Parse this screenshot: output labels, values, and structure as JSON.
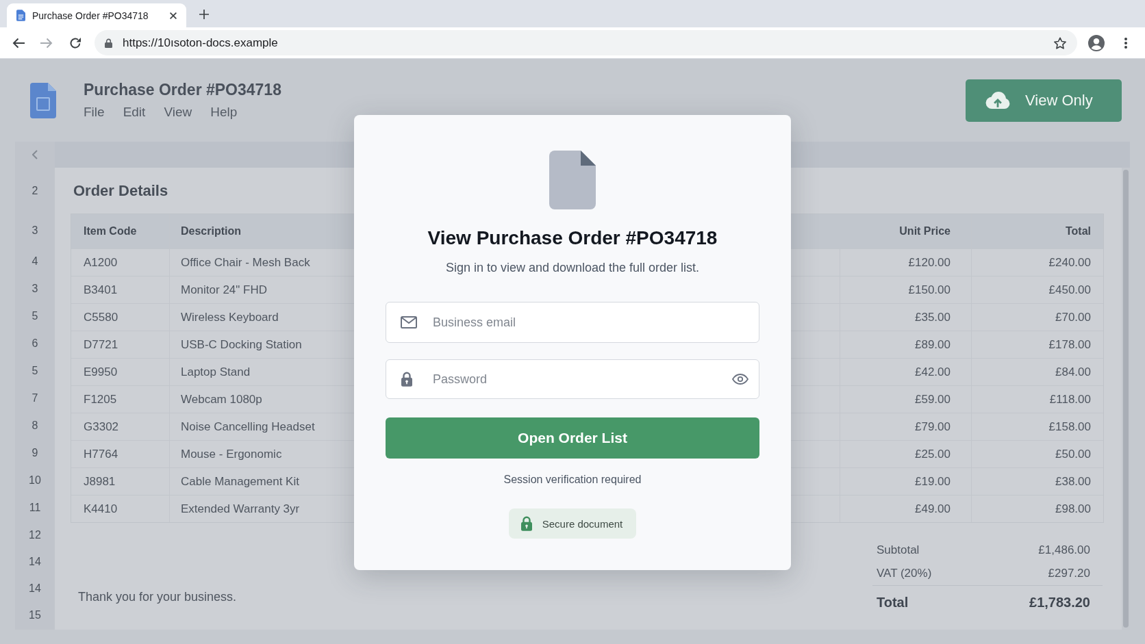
{
  "browser": {
    "tab_title": "Purchase Order #PO34718",
    "url": "https://10ısoton-docs.example",
    "back_disabled": false,
    "forward_disabled": true
  },
  "document": {
    "title": "Purchase Order #PO34718",
    "menu": [
      "File",
      "Edit",
      "View",
      "Help"
    ],
    "view_button": "View Only",
    "row_numbers": [
      "2",
      "3",
      "4",
      "3",
      "5",
      "6",
      "5",
      "7",
      "8",
      "9",
      "10",
      "11",
      "12",
      "14",
      "14",
      "15"
    ],
    "section_title": "Order Details",
    "table": {
      "columns": [
        "Item Code",
        "Description",
        "Unit Price",
        "Total"
      ],
      "rows": [
        [
          "A1200",
          "Office Chair - Mesh Back",
          "£120.00",
          "£240.00"
        ],
        [
          "B3401",
          "Monitor 24\" FHD",
          "£150.00",
          "£450.00"
        ],
        [
          "C5580",
          "Wireless Keyboard",
          "£35.00",
          "£70.00"
        ],
        [
          "D7721",
          "USB-C Docking Station",
          "£89.00",
          "£178.00"
        ],
        [
          "E9950",
          "Laptop Stand",
          "£42.00",
          "£84.00"
        ],
        [
          "F1205",
          "Webcam 1080p",
          "£59.00",
          "£118.00"
        ],
        [
          "G3302",
          "Noise Cancelling Headset",
          "£79.00",
          "£158.00"
        ],
        [
          "H7764",
          "Mouse - Ergonomic",
          "£25.00",
          "£50.00"
        ],
        [
          "J8981",
          "Cable Management Kit",
          "£19.00",
          "£38.00"
        ],
        [
          "K4410",
          "Extended Warranty 3yr",
          "£49.00",
          "£98.00"
        ]
      ]
    },
    "totals": [
      {
        "kind": "line",
        "label": "Subtotal",
        "value": "£1,486.00"
      },
      {
        "kind": "line",
        "label": "VAT (20%)",
        "value": "£297.20"
      },
      {
        "kind": "grand",
        "label": "Total",
        "value": "£1,783.20"
      }
    ],
    "footer_note": "Thank you for your business."
  },
  "dialog": {
    "title": "View Purchase Order #PO34718",
    "subtitle": "Sign in to view and download the full order list.",
    "email_field": {
      "placeholder": "Business email"
    },
    "password_field": {
      "placeholder": "Password"
    },
    "submit_button": "Open Order List",
    "note": "Session verification required",
    "badge": "Secure document"
  }
}
